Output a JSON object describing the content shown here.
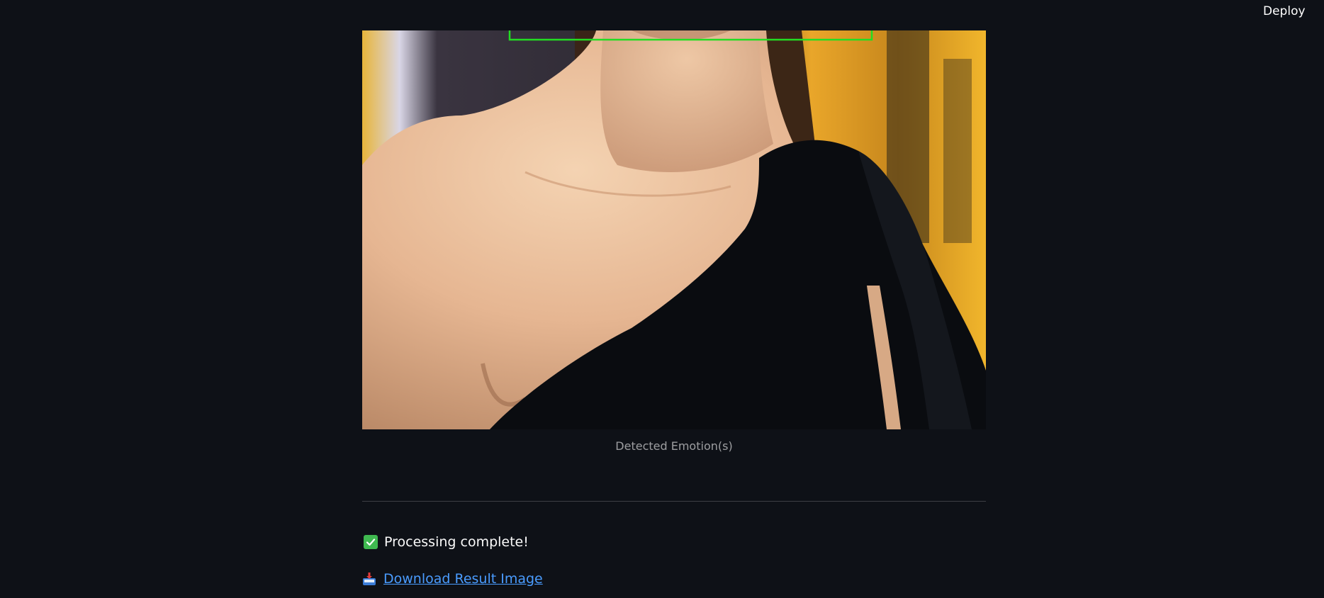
{
  "header": {
    "deploy_label": "Deploy"
  },
  "result": {
    "caption": "Detected Emotion(s)",
    "bounding_box_color": "#22dd22"
  },
  "status": {
    "icon": "check-icon",
    "icon_color": "#3fb950",
    "message": "Processing complete!"
  },
  "download": {
    "icon": "inbox-tray-icon",
    "label": "Download Result Image",
    "link_color": "#4a9cff"
  },
  "colors": {
    "background": "#0e1117",
    "text": "#fafafa"
  }
}
